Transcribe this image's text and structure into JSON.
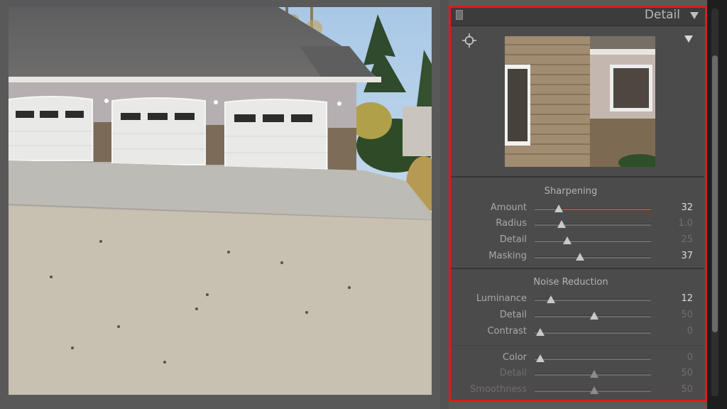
{
  "panel": {
    "title": "Detail",
    "accent_outline_color": "#e01b1b",
    "icons": {
      "header_handle": "panel-handle-icon",
      "collapse": "triangle-down-icon",
      "target": "crosshair-target-icon",
      "preview_menu": "triangle-down-icon"
    }
  },
  "sharpening": {
    "title": "Sharpening",
    "rows": [
      {
        "label": "Amount",
        "value": "32",
        "fraction": 0.21,
        "active": true,
        "accent": "#d43c3c"
      },
      {
        "label": "Radius",
        "value": "1.0",
        "fraction": 0.23,
        "active": true,
        "value_dim": true
      },
      {
        "label": "Detail",
        "value": "25",
        "fraction": 0.28,
        "active": true,
        "value_dim": true
      },
      {
        "label": "Masking",
        "value": "37",
        "fraction": 0.39,
        "active": true
      }
    ]
  },
  "noise_reduction": {
    "title": "Noise Reduction",
    "rows": [
      {
        "label": "Luminance",
        "value": "12",
        "fraction": 0.14,
        "active": true
      },
      {
        "label": "Detail",
        "value": "50",
        "fraction": 0.51,
        "active": true,
        "value_dim": true
      },
      {
        "label": "Contrast",
        "value": "0",
        "fraction": 0.05,
        "active": true,
        "value_dim": true
      },
      {
        "label": "Color",
        "value": "0",
        "fraction": 0.05,
        "active": true,
        "value_dim": true
      },
      {
        "label": "Detail",
        "value": "50",
        "fraction": 0.51,
        "active": false
      },
      {
        "label": "Smoothness",
        "value": "50",
        "fraction": 0.51,
        "active": false
      }
    ]
  }
}
